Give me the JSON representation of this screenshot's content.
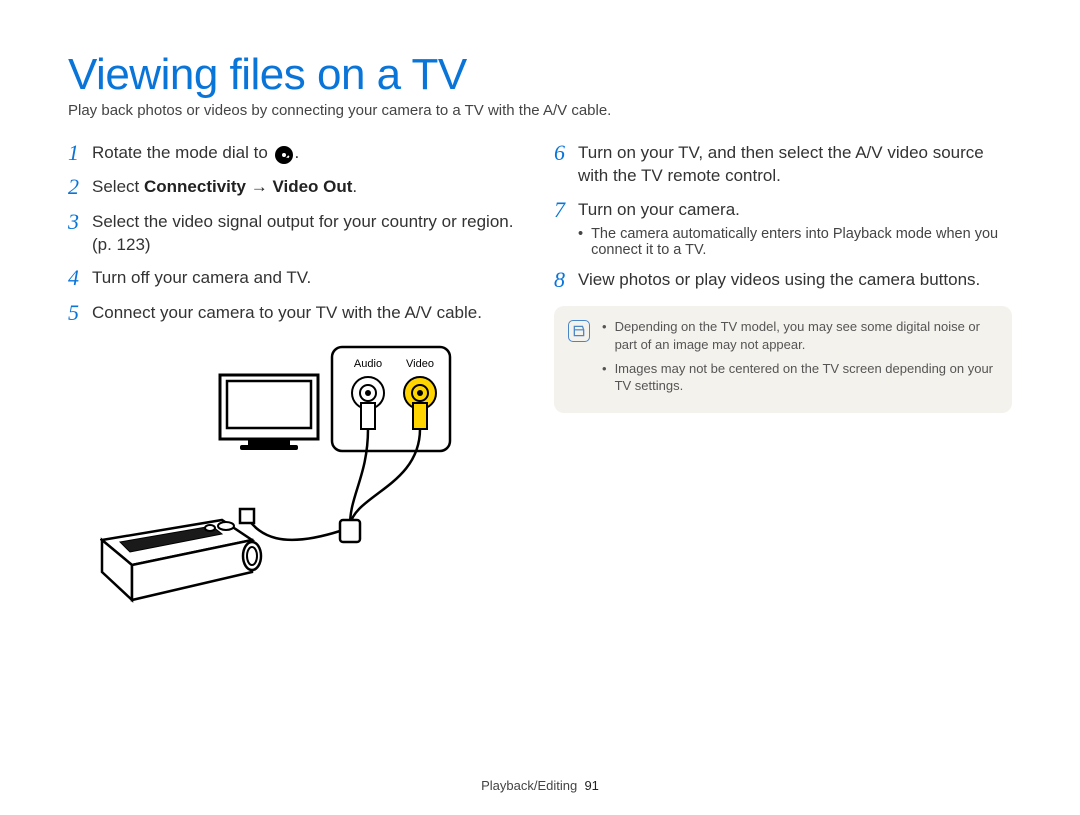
{
  "title": "Viewing files on a TV",
  "intro": "Play back photos or videos by connecting your camera to a TV with the A/V cable.",
  "steps_left": [
    {
      "num": "1",
      "body_pre": "Rotate the mode dial to ",
      "body_post": "."
    },
    {
      "num": "2",
      "body_pre": "Select ",
      "bold": "Connectivity → Video Out",
      "body_post": "."
    },
    {
      "num": "3",
      "body": "Select the video signal output for your country or region. (p. 123)"
    },
    {
      "num": "4",
      "body": "Turn off your camera and TV."
    },
    {
      "num": "5",
      "body": "Connect your camera to your TV with the A/V cable."
    }
  ],
  "steps_right": [
    {
      "num": "6",
      "body": "Turn on your TV, and then select the A/V video source with the TV remote control."
    },
    {
      "num": "7",
      "body": "Turn on your camera.",
      "sub": [
        "The camera automatically enters into Playback mode when you connect it to a TV."
      ]
    },
    {
      "num": "8",
      "body": "View photos or play videos using the camera buttons."
    }
  ],
  "notes": [
    "Depending on the TV model, you may see some digital noise or part of an image may not appear.",
    "Images may not be centered on the TV screen depending on your TV settings."
  ],
  "illus_labels": {
    "audio": "Audio",
    "video": "Video"
  },
  "footer_section": "Playback/Editing",
  "footer_page": "91"
}
